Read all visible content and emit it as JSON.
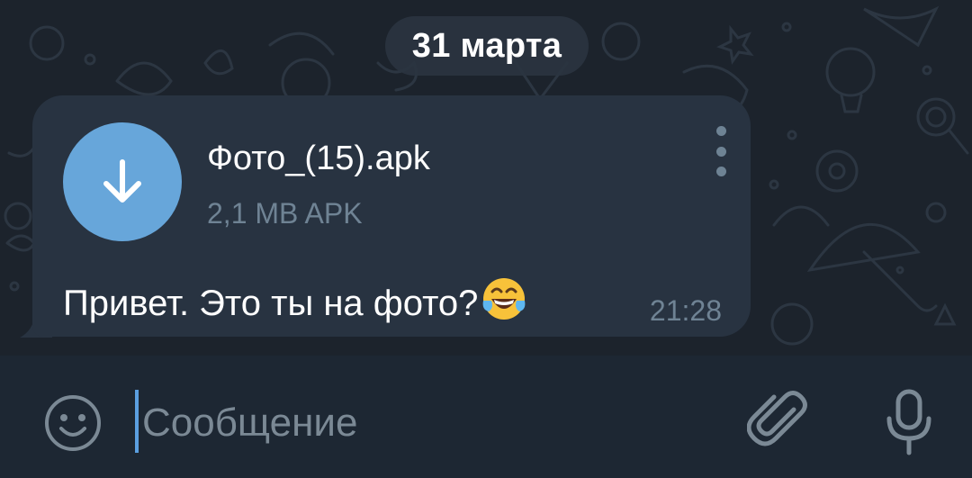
{
  "chat": {
    "date_label": "31 марта"
  },
  "message": {
    "file_name": "Фото_(15).apk",
    "file_meta": "2,1 MB APK",
    "text": "Привет. Это ты на фото?",
    "emoji": "face-with-tears-of-joy",
    "time": "21:28",
    "download_icon": "arrow-down-icon",
    "menu_icon": "vertical-dots-icon"
  },
  "composer": {
    "placeholder": "Сообщение",
    "value": "",
    "emoji_icon": "smile-icon",
    "attach_icon": "paperclip-icon",
    "mic_icon": "microphone-icon"
  },
  "colors": {
    "chat_background": "#1c232c",
    "bubble": "#283341",
    "download_button": "#67a6da",
    "secondary_text": "#6f8394",
    "input_bar": "#1d2733",
    "caret": "#5b9fe0"
  }
}
